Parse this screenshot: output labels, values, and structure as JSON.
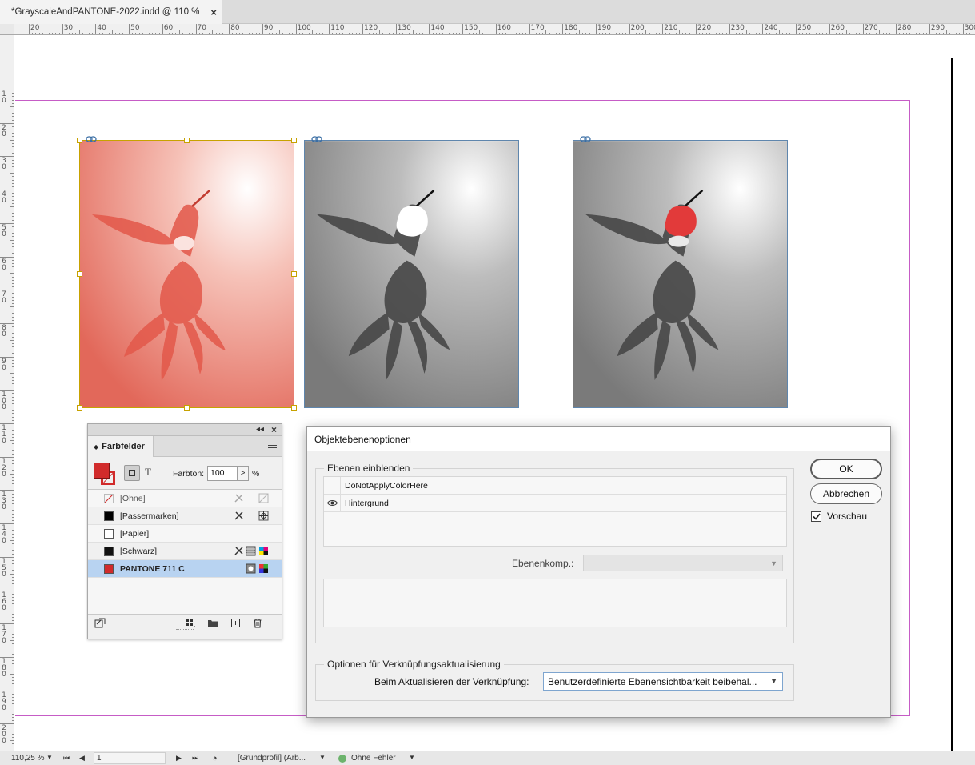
{
  "document": {
    "tab_title": "*GrayscaleAndPANTONE-2022.indd @ 110 %",
    "close_glyph": "×"
  },
  "rulers": {
    "top_labels": [
      "20",
      "30",
      "40",
      "50",
      "60",
      "70",
      "80",
      "90",
      "100",
      "110",
      "120",
      "130",
      "140",
      "150",
      "160",
      "170",
      "180",
      "190",
      "200",
      "210",
      "220",
      "230",
      "240",
      "250",
      "260",
      "270",
      "280",
      "290",
      "300"
    ],
    "left_labels": [
      "1\n0",
      "2\n0",
      "3\n0",
      "4\n0",
      "5\n0",
      "6\n0",
      "7\n0",
      "8\n0",
      "9\n0",
      "1\n0\n0",
      "1\n1\n0",
      "1\n2\n0",
      "1\n3\n0",
      "1\n4\n0",
      "1\n5\n0",
      "1\n6\n0",
      "1\n7\n0",
      "1\n8\n0",
      "1\n9\n0",
      "2\n0\n0"
    ]
  },
  "colors": {
    "pantone": "#d12b2b",
    "selection": "#c7a200",
    "margin": "#c65cc6",
    "frame": "#5f86ad"
  },
  "swatches_panel": {
    "title": "Farbfelder",
    "collapse_glyph": "◂◂",
    "close_glyph": "×",
    "text_button": "T",
    "tint_label": "Farbton:",
    "tint_value": "100",
    "tint_arrow": ">",
    "tint_unit": "%",
    "items": [
      {
        "name": "[Ohne]",
        "color": "none"
      },
      {
        "name": "[Passermarken]",
        "color": "#000000"
      },
      {
        "name": "[Papier]",
        "color": "#ffffff"
      },
      {
        "name": "[Schwarz]",
        "color": "#111111"
      },
      {
        "name": "PANTONE 711 C",
        "color": "#d12b2b"
      }
    ]
  },
  "dialog": {
    "title": "Objektebenenoptionen",
    "layers_group_label": "Ebenen einblenden",
    "layers": [
      {
        "name": "DoNotApplyColorHere",
        "visible": false
      },
      {
        "name": "Hintergrund",
        "visible": true
      }
    ],
    "layer_comp_label": "Ebenenkomp.:",
    "layer_comp_value": "",
    "update_group_label": "Optionen für Verknüpfungsaktualisierung",
    "update_label": "Beim Aktualisieren der Verknüpfung:",
    "update_value": "Benutzerdefinierte Ebenensichtbarkeit beibehal...",
    "ok_label": "OK",
    "cancel_label": "Abbrechen",
    "preview_label": "Vorschau",
    "preview_checked": true
  },
  "statusbar": {
    "zoom": "110,25 %",
    "page": "1",
    "profile": "[Grundprofil] (Arb...",
    "errors": "Ohne Fehler"
  }
}
